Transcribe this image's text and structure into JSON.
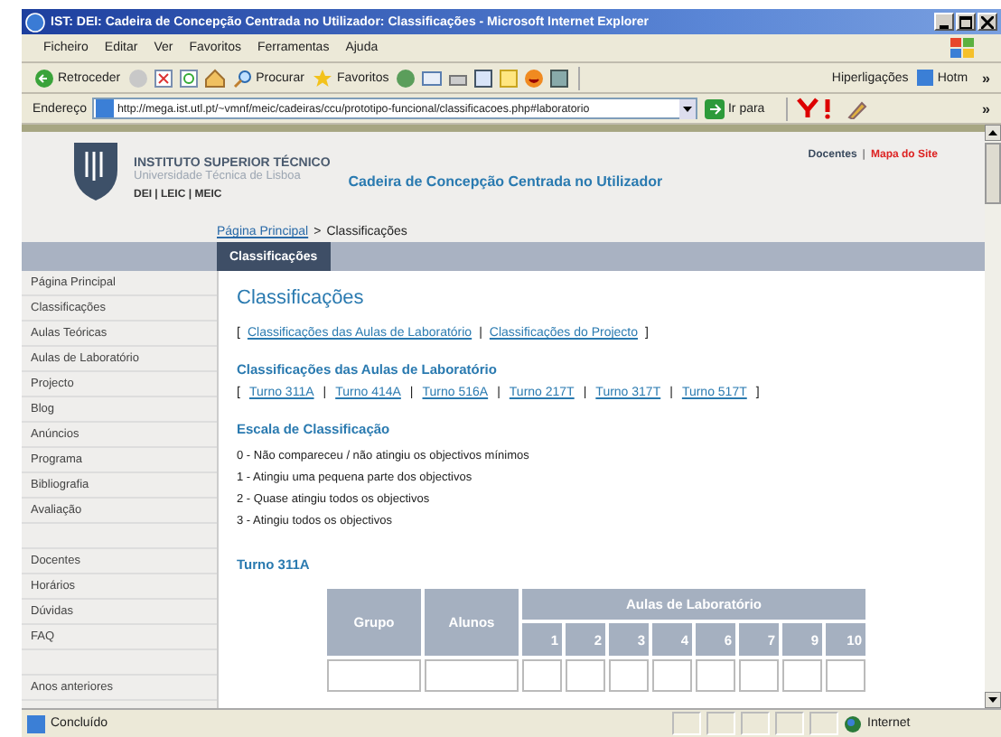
{
  "window": {
    "title": "IST: DEI: Cadeira de Concepção Centrada no Utilizador: Classificações - Microsoft Internet Explorer"
  },
  "menu": [
    "Ficheiro",
    "Editar",
    "Ver",
    "Favoritos",
    "Ferramentas",
    "Ajuda"
  ],
  "toolbar": {
    "back": "Retroceder",
    "search": "Procurar",
    "favorites": "Favoritos",
    "links": "Hiperligações",
    "hotmail": "Hotm",
    "more": "»"
  },
  "address": {
    "label": "Endereço",
    "url": "http://mega.ist.utl.pt/~vmnf/meic/cadeiras/ccu/prototipo-funcional/classificacoes.php#laboratorio",
    "go": "Ir para",
    "more": "»"
  },
  "header": {
    "institution": "INSTITUTO SUPERIOR TÉCNICO",
    "university": "Universidade Técnica de Lisboa",
    "departments": "DEI | LEIC | MEIC",
    "course": "Cadeira de Concepção Centrada no Utilizador",
    "top_links": [
      {
        "label": "Docentes",
        "kind": "plain"
      },
      {
        "label": "|",
        "kind": "separator"
      },
      {
        "label": "Mapa do Site",
        "kind": "highlight"
      }
    ]
  },
  "breadcrumb": {
    "link": "Página Principal",
    "separator": ">",
    "current": "Classificações"
  },
  "tabs": [
    {
      "label": "Classificações",
      "selected": true
    }
  ],
  "sidebar": {
    "groups": [
      [
        "Página Principal",
        "Classificações",
        "Aulas Teóricas",
        "Aulas de Laboratório",
        "Projecto",
        "Blog",
        "Anúncios",
        "Programa",
        "Bibliografia",
        "Avaliação"
      ],
      [
        "Docentes",
        "Horários",
        "Dúvidas",
        "FAQ"
      ],
      [
        "Anos anteriores"
      ]
    ]
  },
  "content": {
    "title": "Classificações",
    "nav": {
      "open": "[",
      "separator": "|",
      "close": "]",
      "links": [
        "Classificações das Aulas de Laboratório",
        "Classificações do Projecto"
      ]
    },
    "lab_heading": "Classificações das Aulas de Laboratório",
    "turnos": {
      "open": "[",
      "separator": "|",
      "close": "]",
      "links": [
        "Turno 311A",
        "Turno 414A",
        "Turno 516A",
        "Turno 217T",
        "Turno 317T",
        "Turno 517T"
      ]
    },
    "scale_heading": "Escala de Classificação",
    "scale": [
      "0 - Não compareceu / não atingiu os objectivos mínimos",
      "1 - Atingiu uma pequena parte dos objectivos",
      "2 - Quase atingiu todos os objectivos",
      "3 - Atingiu todos os objectivos"
    ],
    "table_heading": "Turno 311A",
    "table": {
      "columns": [
        "Grupo",
        "Alunos"
      ],
      "group_header": "Aulas de Laboratório",
      "sessions": [
        "1",
        "2",
        "3",
        "4",
        "6",
        "7",
        "9",
        "10"
      ]
    }
  },
  "status_bar": {
    "text": "Concluído",
    "zone": "Internet"
  }
}
